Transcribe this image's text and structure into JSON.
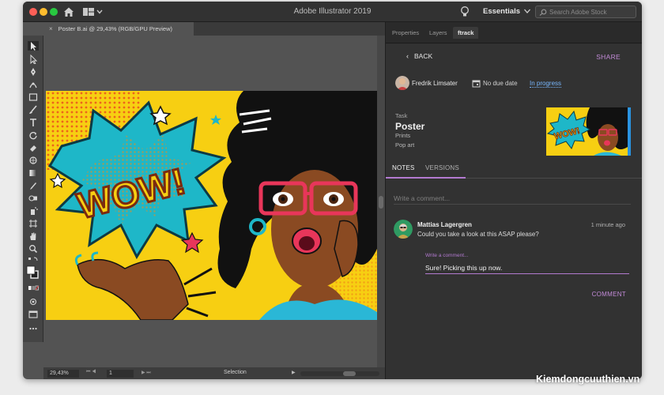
{
  "titlebar": {
    "app_title": "Adobe Illustrator 2019",
    "workspace": "Essentials",
    "stock_search_placeholder": "Search Adobe Stock"
  },
  "document": {
    "tab_title": "Poster B.ai @ 29,43% (RGB/GPU Preview)"
  },
  "artwork": {
    "text": "WOW!"
  },
  "statusbar": {
    "zoom": "29,43%",
    "page": "1",
    "current_tool": "Selection"
  },
  "panel": {
    "tabs": [
      {
        "label": "Properties"
      },
      {
        "label": "Layers"
      },
      {
        "label": "ftrack"
      }
    ],
    "active_tab": "ftrack",
    "back_label": "BACK",
    "share_label": "SHARE",
    "assignee": "Fredrik Limsater",
    "due_date": "No due date",
    "status": "In progress",
    "task": {
      "label": "Task",
      "title": "Poster",
      "line1": "Prints",
      "line2": "Pop art"
    },
    "subtabs": [
      {
        "label": "NOTES"
      },
      {
        "label": "VERSIONS"
      }
    ],
    "comment_placeholder": "Write a comment...",
    "comment": {
      "author": "Mattias Lagergren",
      "time": "1 minute ago",
      "body": "Could you take a look at this ASAP please?"
    },
    "reply": {
      "label": "Write a comment...",
      "value": "Sure! Picking this up now."
    },
    "comment_button": "COMMENT"
  },
  "watermark": "Kiemdongcuuthien.vn",
  "colors": {
    "accent_purple": "#b37ad0",
    "status_blue": "#79b8ff",
    "panel_bg": "#323232",
    "canvas_bg": "#535353",
    "art_yellow": "#f7cf12",
    "art_cyan": "#1eb7c8"
  }
}
